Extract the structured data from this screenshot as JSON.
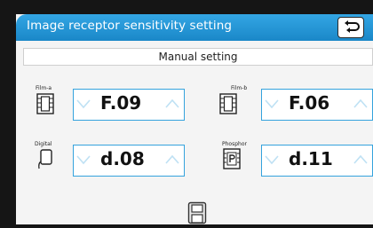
{
  "header": {
    "title": "Image receptor sensitivity setting"
  },
  "mode": {
    "label": "Manual setting"
  },
  "receptors": [
    {
      "label": "Film-a",
      "value": "F.09",
      "icon": "film-icon"
    },
    {
      "label": "Film-b",
      "value": "F.06",
      "icon": "film-icon"
    },
    {
      "label": "Digital",
      "value": "d.08",
      "icon": "digital-sensor-icon"
    },
    {
      "label": "Phosphor",
      "value": "d.11",
      "icon": "phosphor-plate-icon"
    }
  ],
  "footer": {
    "icon": "save-icon"
  },
  "colors": {
    "accent": "#1f93d6",
    "arrow": "#bfe1f4"
  }
}
